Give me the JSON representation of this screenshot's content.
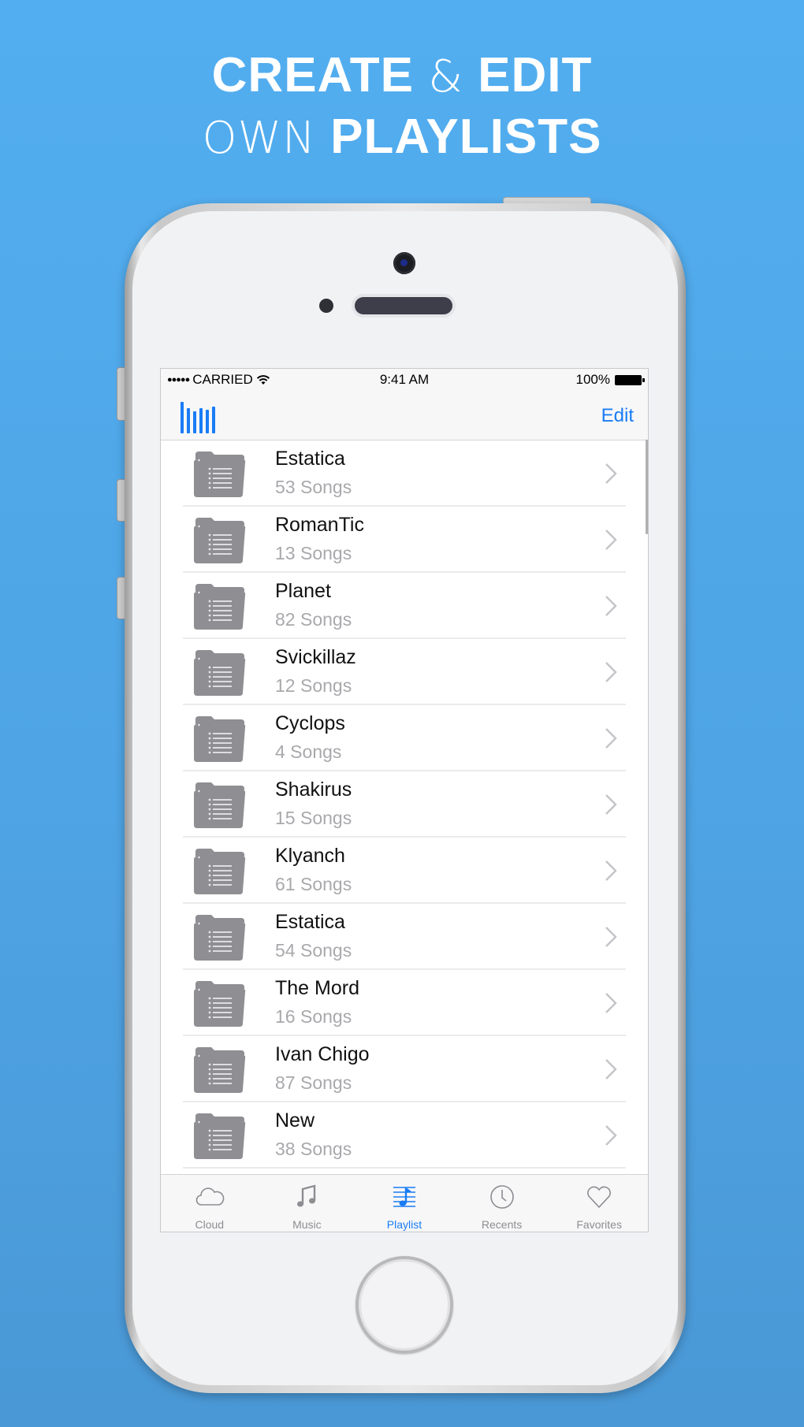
{
  "headline": {
    "line1_bold_a": "CREATE",
    "line1_light": "&",
    "line1_bold_b": "EDIT",
    "line2_light": "OWN",
    "line2_bold": "PLAYLISTS"
  },
  "statusbar": {
    "signal": "●●●●●",
    "carrier": "CARRIED",
    "wifi_icon": "wifi-icon",
    "time": "9:41 AM",
    "battery_percent": "100%",
    "battery_icon": "battery-icon"
  },
  "navbar": {
    "left_icon": "equalizer-icon",
    "edit_label": "Edit"
  },
  "playlists": [
    {
      "name": "Estatica",
      "count": "53 Songs"
    },
    {
      "name": "RomanTic",
      "count": "13 Songs"
    },
    {
      "name": "Planet",
      "count": "82 Songs"
    },
    {
      "name": "Svickillaz",
      "count": "12 Songs"
    },
    {
      "name": "Cyclops",
      "count": "4 Songs"
    },
    {
      "name": "Shakirus",
      "count": "15 Songs"
    },
    {
      "name": "Klyanch",
      "count": "61 Songs"
    },
    {
      "name": "Estatica",
      "count": "54 Songs"
    },
    {
      "name": "The Mord",
      "count": "16 Songs"
    },
    {
      "name": "Ivan Chigo",
      "count": "87 Songs"
    },
    {
      "name": "New",
      "count": "38 Songs"
    }
  ],
  "tabs": [
    {
      "label": "Cloud",
      "icon": "cloud-icon",
      "active": false
    },
    {
      "label": "Music",
      "icon": "music-note-icon",
      "active": false
    },
    {
      "label": "Playlist",
      "icon": "playlist-icon",
      "active": true
    },
    {
      "label": "Recents",
      "icon": "clock-icon",
      "active": false
    },
    {
      "label": "Favorites",
      "icon": "heart-icon",
      "active": false
    }
  ],
  "colors": {
    "background": "#52aef0",
    "accent": "#1a7cf5",
    "folder_gray": "#8e8e93",
    "subtitle_gray": "#a9a9ad"
  }
}
